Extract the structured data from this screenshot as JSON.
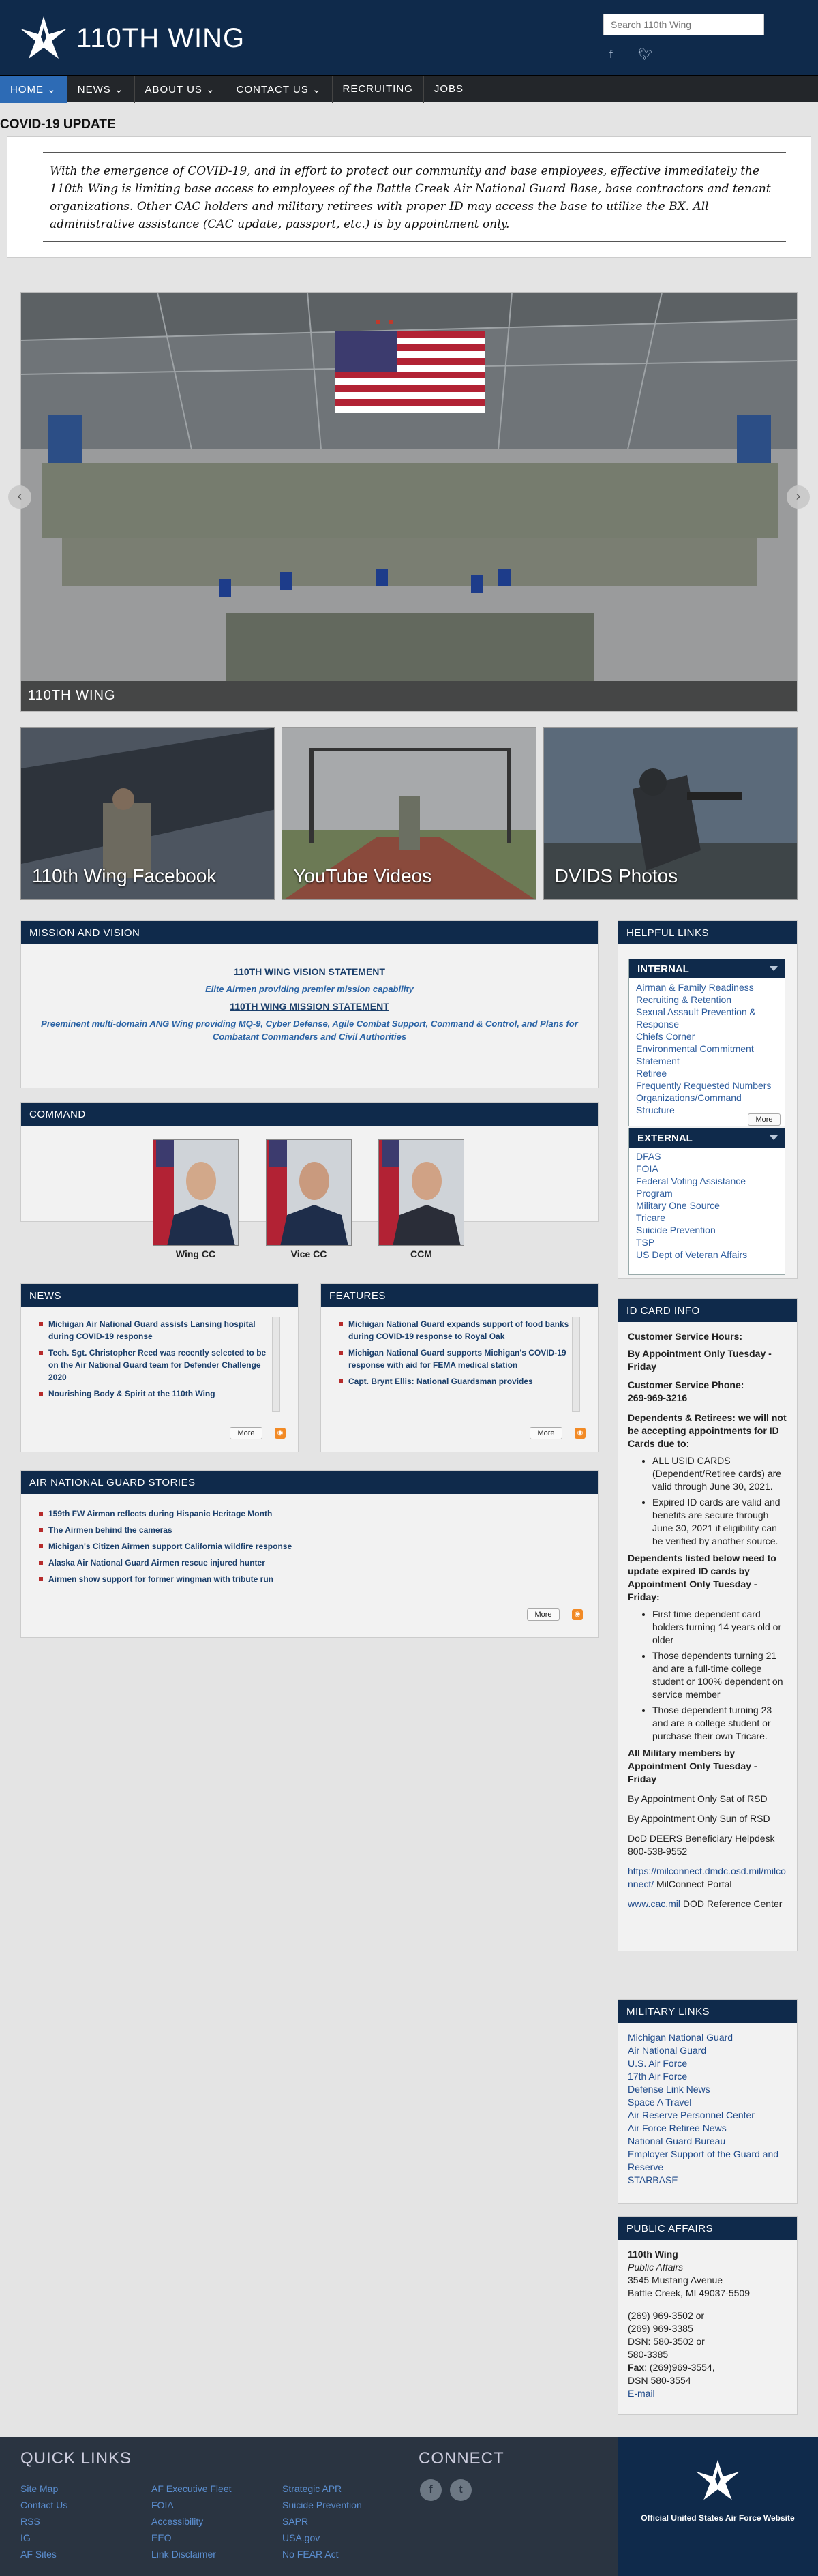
{
  "header": {
    "site_title": "110TH WING",
    "search_placeholder": "Search 110th Wing"
  },
  "nav": [
    {
      "label": "HOME ⌄"
    },
    {
      "label": "NEWS ⌄"
    },
    {
      "label": "ABOUT US ⌄"
    },
    {
      "label": "CONTACT US ⌄"
    },
    {
      "label": "RECRUITING"
    },
    {
      "label": "JOBS"
    }
  ],
  "covid": {
    "title": "COVID-19 UPDATE",
    "text": "With the emergence of COVID-19, and in effort to protect our community and base employees, effective immediately the 110th Wing is limiting base access to employees of the Battle Creek Air National Guard Base, base contractors and tenant organizations. Other CAC holders and military retirees with proper ID may access the base to utilize the BX. All administrative assistance (CAC update, passport, etc.) is by appointment only."
  },
  "hero": {
    "caption": "110TH WING"
  },
  "tiles": [
    {
      "label": "110th Wing Facebook"
    },
    {
      "label": "YouTube Videos"
    },
    {
      "label": "DVIDS Photos"
    }
  ],
  "mission": {
    "title": "MISSION AND VISION",
    "vision_heading": "110TH WING VISION STATEMENT",
    "vision_text": "Elite Airmen providing premier mission capability",
    "mission_heading": "110TH WING MISSION STATEMENT",
    "mission_text": "Preeminent multi-domain ANG Wing providing MQ-9, Cyber Defense, Agile Combat Support, Command & Control, and Plans for Combatant Commanders and Civil Authorities"
  },
  "command": {
    "title": "COMMAND",
    "members": [
      {
        "caption": "Wing CC"
      },
      {
        "caption": "Vice CC"
      },
      {
        "caption": "CCM"
      }
    ]
  },
  "news": {
    "title": "NEWS",
    "items": [
      "Michigan Air National Guard assists Lansing hospital during COVID-19 response",
      "Tech. Sgt. Christopher Reed was recently selected to be on the Air National Guard team for Defender Challenge 2020",
      "Nourishing Body & Spirit at the 110th Wing"
    ],
    "more": "More"
  },
  "features": {
    "title": "FEATURES",
    "items": [
      "Michigan National Guard expands support of food banks during COVID-19 response to Royal Oak",
      "Michigan National Guard supports Michigan's COVID-19 response with aid for FEMA medical station",
      "Capt. Brynt Ellis: National Guardsman provides"
    ],
    "more": "More"
  },
  "ang_stories": {
    "title": "AIR NATIONAL GUARD STORIES",
    "items": [
      "159th FW Airman reflects during Hispanic Heritage Month",
      "The Airmen behind the cameras",
      "Michigan's Citizen Airmen support California wildfire response",
      "Alaska Air National Guard Airmen rescue injured hunter",
      "Airmen show support for former wingman with tribute run"
    ],
    "more": "More"
  },
  "helpful_links": {
    "title": "HELPFUL LINKS",
    "internal_title": "INTERNAL",
    "internal": [
      "Airman & Family Readiness",
      "Recruiting & Retention",
      "Sexual Assault Prevention & Response",
      "Chiefs Corner",
      "Environmental Commitment Statement",
      "Retiree",
      "Frequently Requested Numbers",
      "Organizations/Command Structure"
    ],
    "more": "More",
    "external_title": "EXTERNAL",
    "external": [
      "DFAS",
      "FOIA",
      "Federal Voting Assistance Program",
      "Military One Source",
      "Tricare",
      "Suicide Prevention",
      "TSP",
      "US Dept of Veteran Affairs"
    ]
  },
  "id_card": {
    "title": "ID CARD INFO",
    "hours_heading": "Customer Service Hours:",
    "hours": "By Appointment Only Tuesday - Friday",
    "phone_label": "Customer Service Phone:",
    "phone": "269-969-3216",
    "dependents_heading": "Dependents & Retirees: we will not be accepting appointments for ID Cards due to:",
    "reasons": [
      "ALL USID CARDS (Dependent/Retiree cards) are valid through June 30, 2021.",
      "Expired ID cards are valid and benefits are secure through June 30, 2021 if eligibility can be verified by another source."
    ],
    "dependents_listed": "Dependents listed below need to update expired ID cards by Appointment Only Tuesday - Friday:",
    "dependents": [
      "First time dependent card holders turning 14 years old or older",
      "Those dependents turning 21 and are a full-time college student or 100% dependent on service member",
      "Those dependent turning 23 and are a college student or purchase their own Tricare."
    ],
    "all_military": "All Military members by Appointment Only Tuesday - Friday",
    "sat": "By Appointment Only Sat of RSD",
    "sun": "By Appointment Only Sun of RSD",
    "deers": "DoD DEERS Beneficiary Helpdesk 800-538-9552",
    "milconnect_link": "https://milconnect.dmdc.osd.mil/milconnect/",
    "milconnect_text": " MilConnect Portal",
    "cac_link": "www.cac.mil",
    "cac_text": " DOD Reference Center"
  },
  "military_links": {
    "title": "MILITARY LINKS",
    "items": [
      "Michigan National Guard",
      "Air National Guard",
      "U.S. Air Force",
      "17th Air Force",
      "Defense Link News",
      "Space A Travel",
      "Air Reserve Personnel Center",
      "Air Force Retiree News",
      "National Guard Bureau",
      "Employer Support of the Guard and Reserve",
      "STARBASE"
    ]
  },
  "public_affairs": {
    "title": "PUBLIC AFFAIRS",
    "name": "110th Wing",
    "dept": "Public Affairs",
    "addr1": "3545 Mustang Avenue",
    "addr2": "Battle Creek, MI 49037-5509",
    "phone1": "(269) 969-3502 or",
    "phone2": "(269) 969-3385",
    "dsn1": "DSN: 580-3502 or",
    "dsn2": "580-3385",
    "fax_label": "Fax",
    "fax": ": (269)969-3554,",
    "dsn3": "DSN 580-3554",
    "email": "E-mail"
  },
  "footer": {
    "quick_links_title": "QUICK LINKS",
    "col1": [
      "Site Map",
      "Contact Us",
      "RSS",
      "IG",
      "AF Sites"
    ],
    "col2": [
      "AF Executive Fleet",
      "FOIA",
      "Accessibility",
      "EEO",
      "Link Disclaimer"
    ],
    "col3": [
      "Strategic APR",
      "Suicide Prevention",
      "SAPR",
      "USA.gov",
      "No FEAR Act"
    ],
    "connect_title": "CONNECT",
    "official": "Official United States Air Force Website"
  }
}
